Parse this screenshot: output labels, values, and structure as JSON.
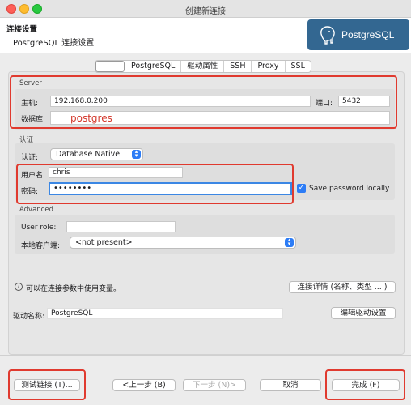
{
  "window": {
    "title": "创建新连接"
  },
  "header": {
    "title": "连接设置",
    "subtitle": "PostgreSQL 连接设置",
    "logo_text": "PostgreSQL",
    "logo_color": "#336791"
  },
  "tabs": [
    {
      "label": ""
    },
    {
      "label": "PostgreSQL"
    },
    {
      "label": "驱动属性"
    },
    {
      "label": "SSH"
    },
    {
      "label": "Proxy"
    },
    {
      "label": "SSL"
    }
  ],
  "server": {
    "section_title": "Server",
    "host_label": "主机:",
    "host_value": "192.168.0.200",
    "port_label": "端口:",
    "port_value": "5432",
    "database_label": "数据库:",
    "database_value": "postgres"
  },
  "auth": {
    "section_title": "认证",
    "auth_label": "认证:",
    "auth_value": "Database Native",
    "username_label": "用户名:",
    "username_value": "chris",
    "password_label": "密码:",
    "password_value": "••••••••",
    "save_password_label": "Save password locally",
    "save_password_checked": true
  },
  "advanced": {
    "section_title": "Advanced",
    "user_role_label": "User role:",
    "user_role_value": "",
    "local_client_label": "本地客户端:",
    "local_client_value": "<not present>"
  },
  "info": {
    "text": "可以在连接参数中使用变量。",
    "details_button": "连接详情 (名称、类型 ... )"
  },
  "driver": {
    "label": "驱动名称:",
    "value": "PostgreSQL",
    "edit_button": "编辑驱动设置"
  },
  "footer": {
    "test_button": "测试链接 (T)...",
    "prev_button": "<上一步 (B)",
    "next_button": "下一步 (N)>",
    "cancel_button": "取消",
    "finish_button": "完成 (F)"
  },
  "colors": {
    "annotation_red": "#e03a2f",
    "accent_blue": "#2c7cf6",
    "database_text_red": "#d4382c"
  }
}
